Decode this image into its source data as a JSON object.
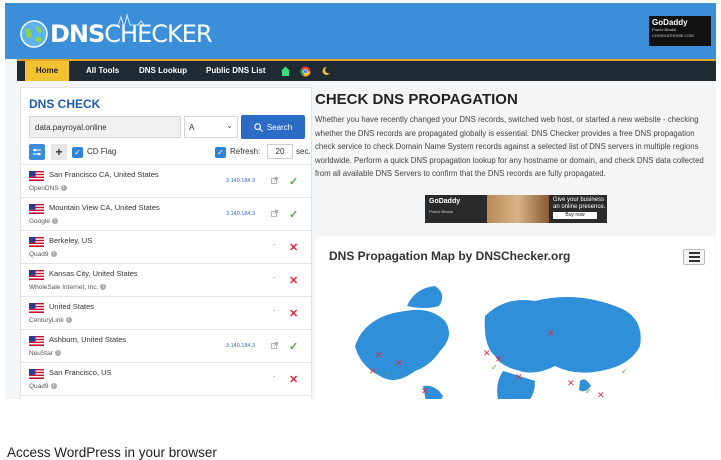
{
  "header": {
    "logo_part1": "DNS",
    "logo_part2": "CHECKER",
    "ad": {
      "brand": "GoDaddy",
      "name": "Prachi Bhatia",
      "sub": "CHOKHATHOME.COM"
    }
  },
  "nav": {
    "items": [
      "Home",
      "All Tools",
      "DNS Lookup",
      "Public DNS List"
    ]
  },
  "dns_check": {
    "title": "DNS CHECK",
    "domain_value": "data.payroyal.online",
    "record_type": "A",
    "search_label": "Search",
    "cd_flag_label": "CD Flag",
    "refresh_label": "Refresh:",
    "refresh_value": "20",
    "refresh_unit": "sec.",
    "servers": [
      {
        "location": "San Francisco CA, United States",
        "provider": "OpenDNS",
        "ip": "3.140.184.3",
        "status": "ok"
      },
      {
        "location": "Mountain View CA, United States",
        "provider": "Google",
        "ip": "3.140.184.3",
        "status": "ok"
      },
      {
        "location": "Berkeley, US",
        "provider": "Quad9",
        "ip": "-",
        "status": "fail"
      },
      {
        "location": "Kansas City, United States",
        "provider": "WholeSale Internet, Inc.",
        "ip": "-",
        "status": "fail"
      },
      {
        "location": "United States",
        "provider": "CenturyLink",
        "ip": "-",
        "status": "fail"
      },
      {
        "location": "Ashburn, United States",
        "provider": "NeuStar",
        "ip": "3.140.184.3",
        "status": "ok"
      },
      {
        "location": "San Francisco, US",
        "provider": "Quad9",
        "ip": "-",
        "status": "fail"
      }
    ]
  },
  "main": {
    "title": "CHECK DNS PROPAGATION",
    "description": "Whether you have recently changed your DNS records, switched web host, or started a new website - checking whether the DNS records are propagated globally is essential. DNS Checker provides a free DNS propagation check service to check Domain Name System records against a selected list of DNS servers in multiple regions worldwide. Perform a quick DNS propagation lookup for any hostname or domain, and check DNS data collected from all available DNS Servers to confirm that the DNS records are fully propagated.",
    "ad": {
      "brand": "GoDaddy",
      "name": "Prachi Bhatia",
      "sub": "CHOKHATHOME.COM",
      "tagline": "Give your business an online presence.",
      "cta": "Buy now"
    },
    "map_title": "DNS Propagation Map by DNSChecker.org"
  },
  "caption": "Access WordPress in your browser",
  "colors": {
    "brand_blue": "#3b8fd9",
    "nav_dark": "#1f2a33",
    "home_yellow": "#f2c230",
    "ok_green": "#58a84a",
    "fail_red": "#e02b3e"
  }
}
